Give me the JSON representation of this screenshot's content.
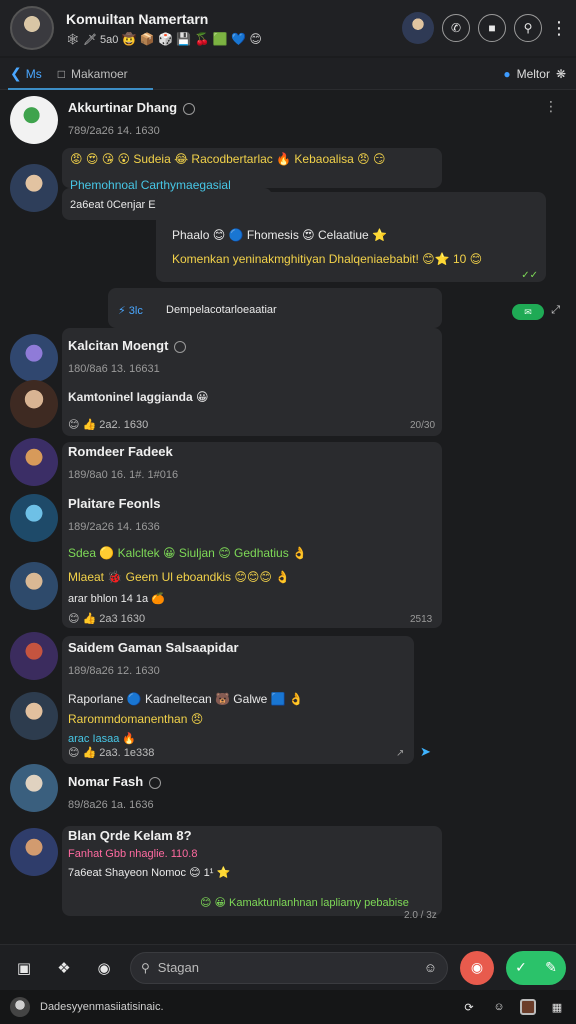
{
  "header": {
    "title": "Komuiltan Namertarn",
    "subtitle_prefix": "🕸 🗡 5a0",
    "subtitle_emojis": "🤠 📦 🎲 💾 🍒 🟩 💙 😊"
  },
  "subheader": {
    "back_icon": "arrow-left-icon",
    "tab_label": "Ms",
    "section_icon": "square-icon",
    "section_label": "Makamoer",
    "right_label": "Meltor"
  },
  "messages": {
    "m1": {
      "name": "Akkurtinar Dhang",
      "meta": "789/2a26 14. 1630"
    },
    "m2": {
      "reaction_line": "😡 😍 😘 😮 Sudeia 😂 Racodbertarlac 🔥 Kebaoalisa 😠 😏",
      "cyan_line": "Phemohnoal Carthymaegasial",
      "sub_line": "2a6eat 0Cenjar Eotarrgas 😊 1¹ 🔥"
    },
    "m3": {
      "line1": "Phaalo 😊 🔵 Fhomesis 😍 Celaatiue ⭐",
      "line2": "Komenkan yeninakmghitiyan Dhalqeniaebabit! 😊⭐ 10 😊",
      "ticks": "✓✓"
    },
    "sys": {
      "tag": "⚡ 3lc",
      "text": "Dempelacotarloeaatiar"
    },
    "pill": "✉",
    "m4": {
      "name": "Kalcitan Moengt",
      "meta": "180/8a6 13. 16631"
    },
    "m5": {
      "name": "Kamtoninel Iaggianda 😀",
      "reactions": "😊 👍 2a2. 1630",
      "ts": "20/30"
    },
    "m6": {
      "name": "Romdeer Fadeek",
      "meta": "189/8a0 16. 1#. 1#016"
    },
    "m7": {
      "name": "Plaitare Feonls",
      "meta": "189/2a26 14. 1636"
    },
    "m8": {
      "line1": "Sdea 🟡 Kalcltek 😀 Siuljan 😊 Gedhatius 👌",
      "line2": "Mlaeat 🐞 Geem Ul eboandkis 😊😊😊 👌",
      "line3": "arar bhlon 14 1a 🍊",
      "reactions": "😊 👍 2a3 1630",
      "ts": "2513"
    },
    "m9": {
      "name": "Saidem Gaman Salsaapidar",
      "meta": "189/8a26 12. 1630"
    },
    "m10": {
      "line1": "Raporlane 🔵 Kadneltecan 🐻 Galwe 🟦 👌",
      "line2": "Rarommdomanenthan 😠",
      "line3": "arac Iasaa 🔥",
      "reactions": "😊 👍 2a3. 1e338",
      "ts": "↗"
    },
    "m11": {
      "name": "Nomar Fash",
      "meta": "89/8a26 1a. 1636"
    },
    "m12": {
      "name": "Blan Qrde Kelam 8?",
      "pink_line": "Fanhat Gbb nhaglie. 110.8",
      "sub_line": "7a6eat Shayeon Nomoc 😊 1¹ ⭐",
      "reply": "😊 😀 Kamaktunlanhnan lapliamy pebabise",
      "ts": "2.0 / 3z"
    }
  },
  "composer": {
    "placeholder": "Stagan"
  },
  "bottombar": {
    "label": "Dadesyyenmasiiatisinaic."
  }
}
